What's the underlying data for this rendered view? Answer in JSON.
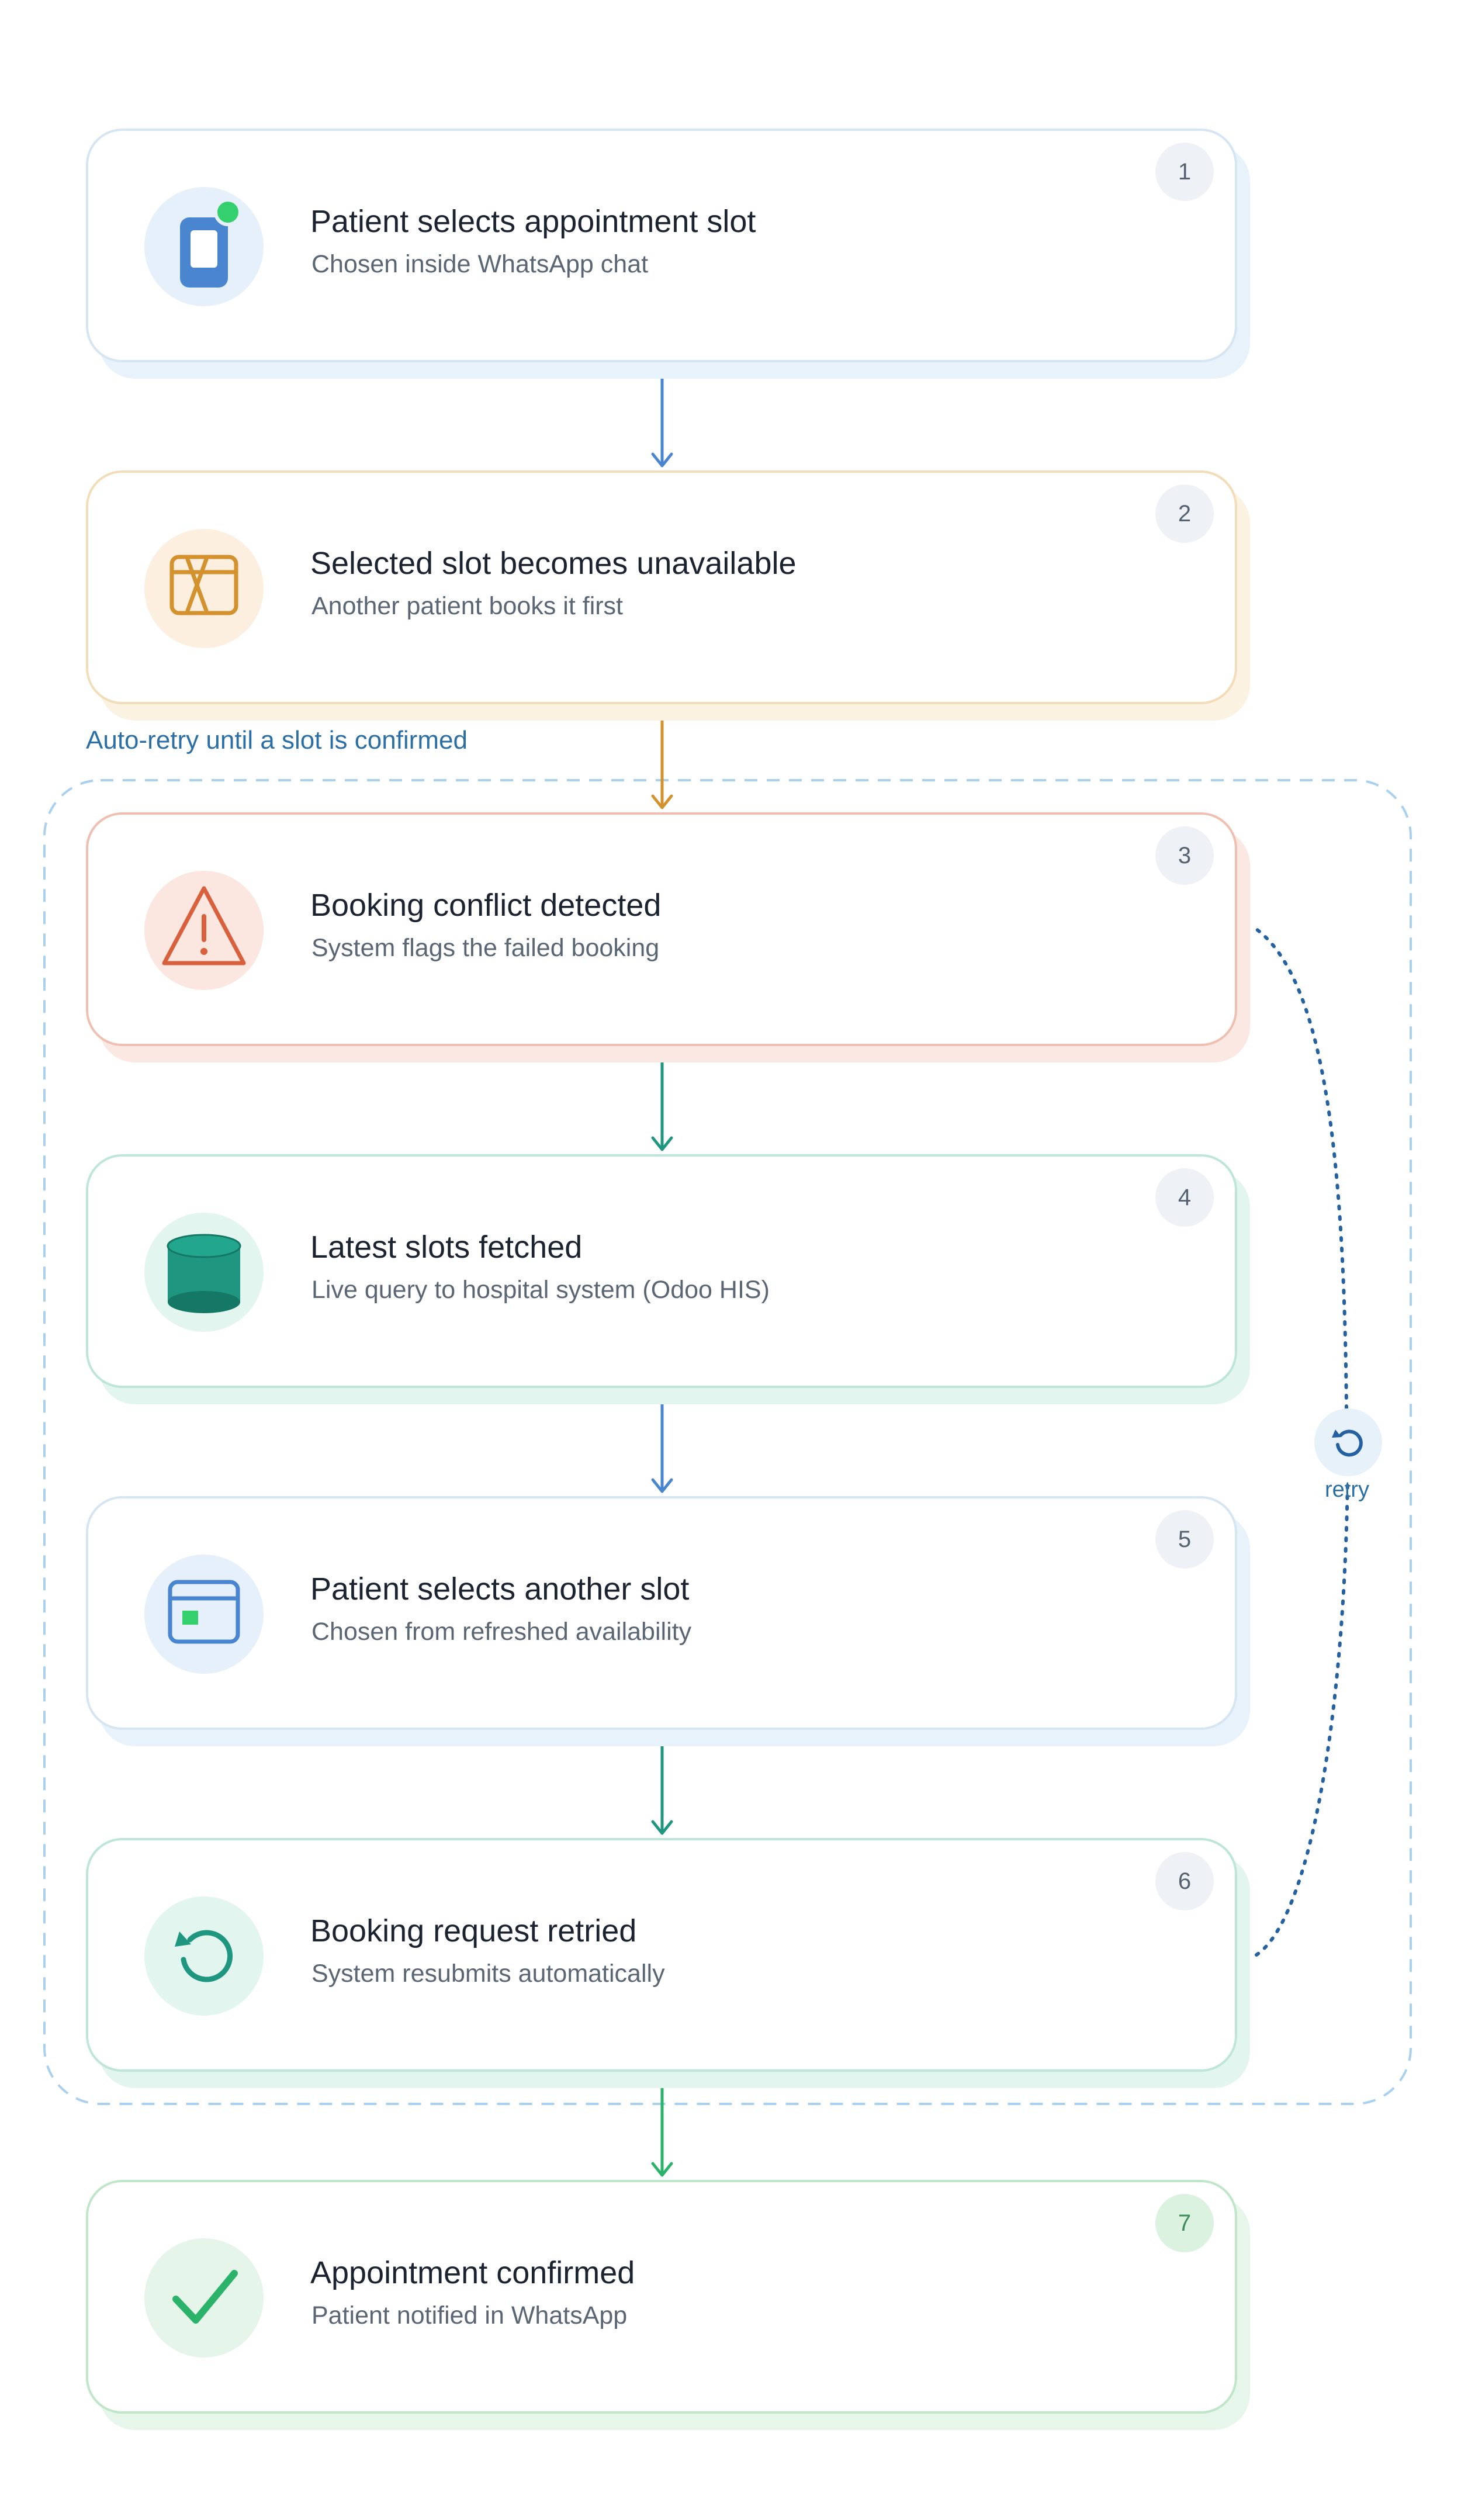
{
  "diagram": {
    "loop_label": "Auto-retry until a slot is confirmed",
    "retry_label": "retry",
    "colors": {
      "blue": "#4a86cf",
      "amber": "#d4922e",
      "coral": "#d9603c",
      "teal": "#1f9680",
      "green": "#2cb36a",
      "loop_dash": "#a9d0ee",
      "retry_dots": "#2560a0"
    },
    "steps": [
      {
        "num": "1",
        "title": "Patient selects appointment slot",
        "subtitle": "Chosen inside WhatsApp chat",
        "icon": "phone-icon",
        "theme": "blue"
      },
      {
        "num": "2",
        "title": "Selected slot becomes unavailable",
        "subtitle": "Another patient books it first",
        "icon": "slot-unavailable-icon",
        "theme": "amber"
      },
      {
        "num": "3",
        "title": "Booking conflict detected",
        "subtitle": "System flags the failed booking",
        "icon": "warning-icon",
        "theme": "coral"
      },
      {
        "num": "4",
        "title": "Latest slots fetched",
        "subtitle": "Live query to hospital system (Odoo HIS)",
        "icon": "database-icon",
        "theme": "teal"
      },
      {
        "num": "5",
        "title": "Patient selects another slot",
        "subtitle": "Chosen from refreshed availability",
        "icon": "calendar-card-icon",
        "theme": "blue"
      },
      {
        "num": "6",
        "title": "Booking request retried",
        "subtitle": "System resubmits automatically",
        "icon": "retry-icon",
        "theme": "teal"
      },
      {
        "num": "7",
        "title": "Appointment confirmed",
        "subtitle": "Patient notified in WhatsApp",
        "icon": "checkmark-icon",
        "theme": "green"
      }
    ],
    "connectors": [
      {
        "from": "1",
        "to": "2",
        "color": "blue"
      },
      {
        "from": "2",
        "to": "3",
        "color": "amber"
      },
      {
        "from": "3",
        "to": "4",
        "color": "teal"
      },
      {
        "from": "4",
        "to": "5",
        "color": "blue"
      },
      {
        "from": "5",
        "to": "6",
        "color": "teal"
      },
      {
        "from": "6",
        "to": "7",
        "color": "green"
      }
    ],
    "retry_loop": {
      "from": "6",
      "to": "3",
      "style": "dotted"
    }
  }
}
